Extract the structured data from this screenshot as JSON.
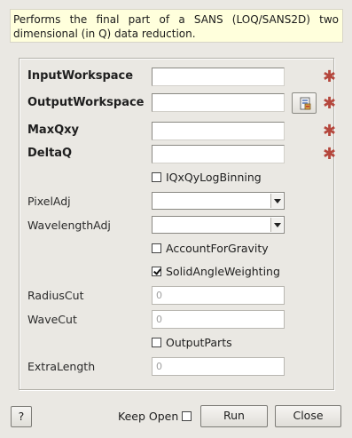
{
  "description": "Performs the final part of a SANS (LOQ/SANS2D) two dimensional (in Q) data reduction.",
  "properties": {
    "input_workspace": {
      "label": "InputWorkspace",
      "value": ""
    },
    "output_workspace": {
      "label": "OutputWorkspace",
      "value": ""
    },
    "max_qxy": {
      "label": "MaxQxy",
      "value": ""
    },
    "delta_q": {
      "label": "DeltaQ",
      "value": ""
    },
    "iqxqy_log_binning": {
      "label": "IQxQyLogBinning",
      "checked": false
    },
    "pixel_adj": {
      "label": "PixelAdj",
      "value": ""
    },
    "wavelength_adj": {
      "label": "WavelengthAdj",
      "value": ""
    },
    "account_for_gravity": {
      "label": "AccountForGravity",
      "checked": false
    },
    "solid_angle_weighting": {
      "label": "SolidAngleWeighting",
      "checked": true
    },
    "radius_cut": {
      "label": "RadiusCut",
      "value": "0"
    },
    "wave_cut": {
      "label": "WaveCut",
      "value": "0"
    },
    "output_parts": {
      "label": "OutputParts",
      "checked": false
    },
    "extra_length": {
      "label": "ExtraLength",
      "value": "0"
    }
  },
  "footer": {
    "help_label": "?",
    "keep_open_label": "Keep Open",
    "keep_open_checked": false,
    "run_label": "Run",
    "close_label": "Close"
  },
  "colors": {
    "required_marker": "#b5473d",
    "description_bg": "#ffffdc",
    "window_bg": "#eae8e3"
  },
  "icons": {
    "required": "required-star-icon",
    "browse": "workspace-browse-icon"
  }
}
